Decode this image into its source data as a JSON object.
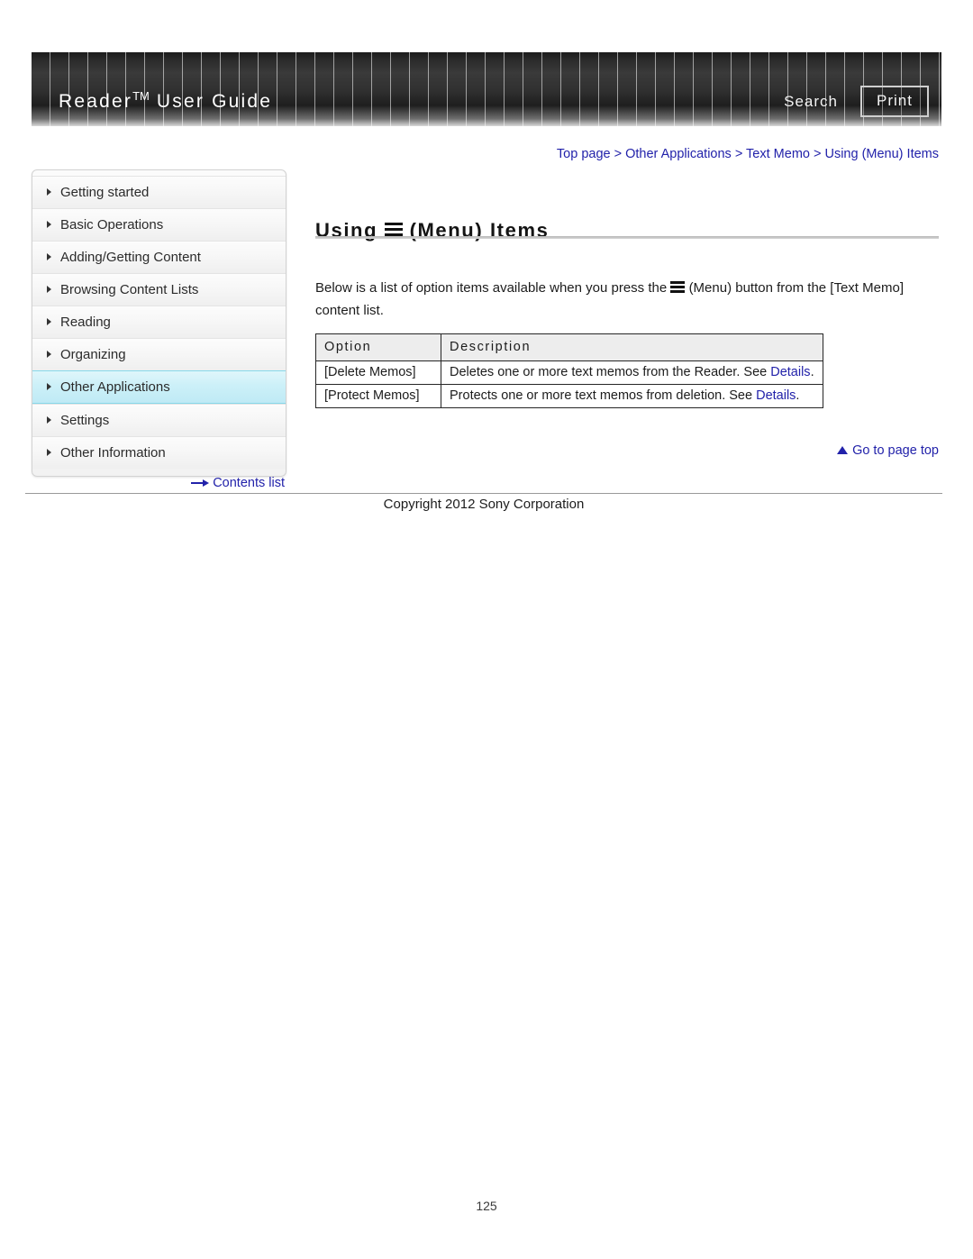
{
  "header": {
    "title": "Reader",
    "title_tm": "TM",
    "title_suffix": " User Guide",
    "search_label": "Search",
    "print_label": "Print"
  },
  "breadcrumb": {
    "text": "Top page > Other Applications > Text Memo > Using (Menu) Items"
  },
  "sidebar": {
    "items": [
      {
        "label": "Getting started",
        "active": false
      },
      {
        "label": "Basic Operations",
        "active": false
      },
      {
        "label": "Adding/Getting Content",
        "active": false
      },
      {
        "label": "Browsing Content Lists",
        "active": false
      },
      {
        "label": "Reading",
        "active": false
      },
      {
        "label": "Organizing",
        "active": false
      },
      {
        "label": "Other Applications",
        "active": true
      },
      {
        "label": "Settings",
        "active": false
      },
      {
        "label": "Other Information",
        "active": false
      }
    ],
    "contents_list_label": "Contents list"
  },
  "main": {
    "title_prefix": "Using",
    "title_suffix": "(Menu) Items",
    "intro_part1": "Below is a list of option items available when you press the",
    "intro_part2": "(Menu) button from the [Text Memo] content list.",
    "table": {
      "headers": [
        "Option",
        "Description"
      ],
      "rows": [
        {
          "option": "[Delete Memos]",
          "description_prefix": "Deletes one or more text memos from the Reader. See ",
          "description_link": "Details",
          "description_suffix": "."
        },
        {
          "option": "[Protect Memos]",
          "description_prefix": "Protects one or more text memos from deletion. See ",
          "description_link": "Details",
          "description_suffix": "."
        }
      ]
    },
    "go_to_top_label": "Go to page top"
  },
  "footer": {
    "copyright": "Copyright 2012 Sony Corporation",
    "page_number": "125"
  },
  "colors": {
    "link": "#2222aa",
    "active_nav_bg": "#ccf0f8",
    "active_nav_border": "#86d8ea",
    "table_header_bg": "#ededed"
  }
}
